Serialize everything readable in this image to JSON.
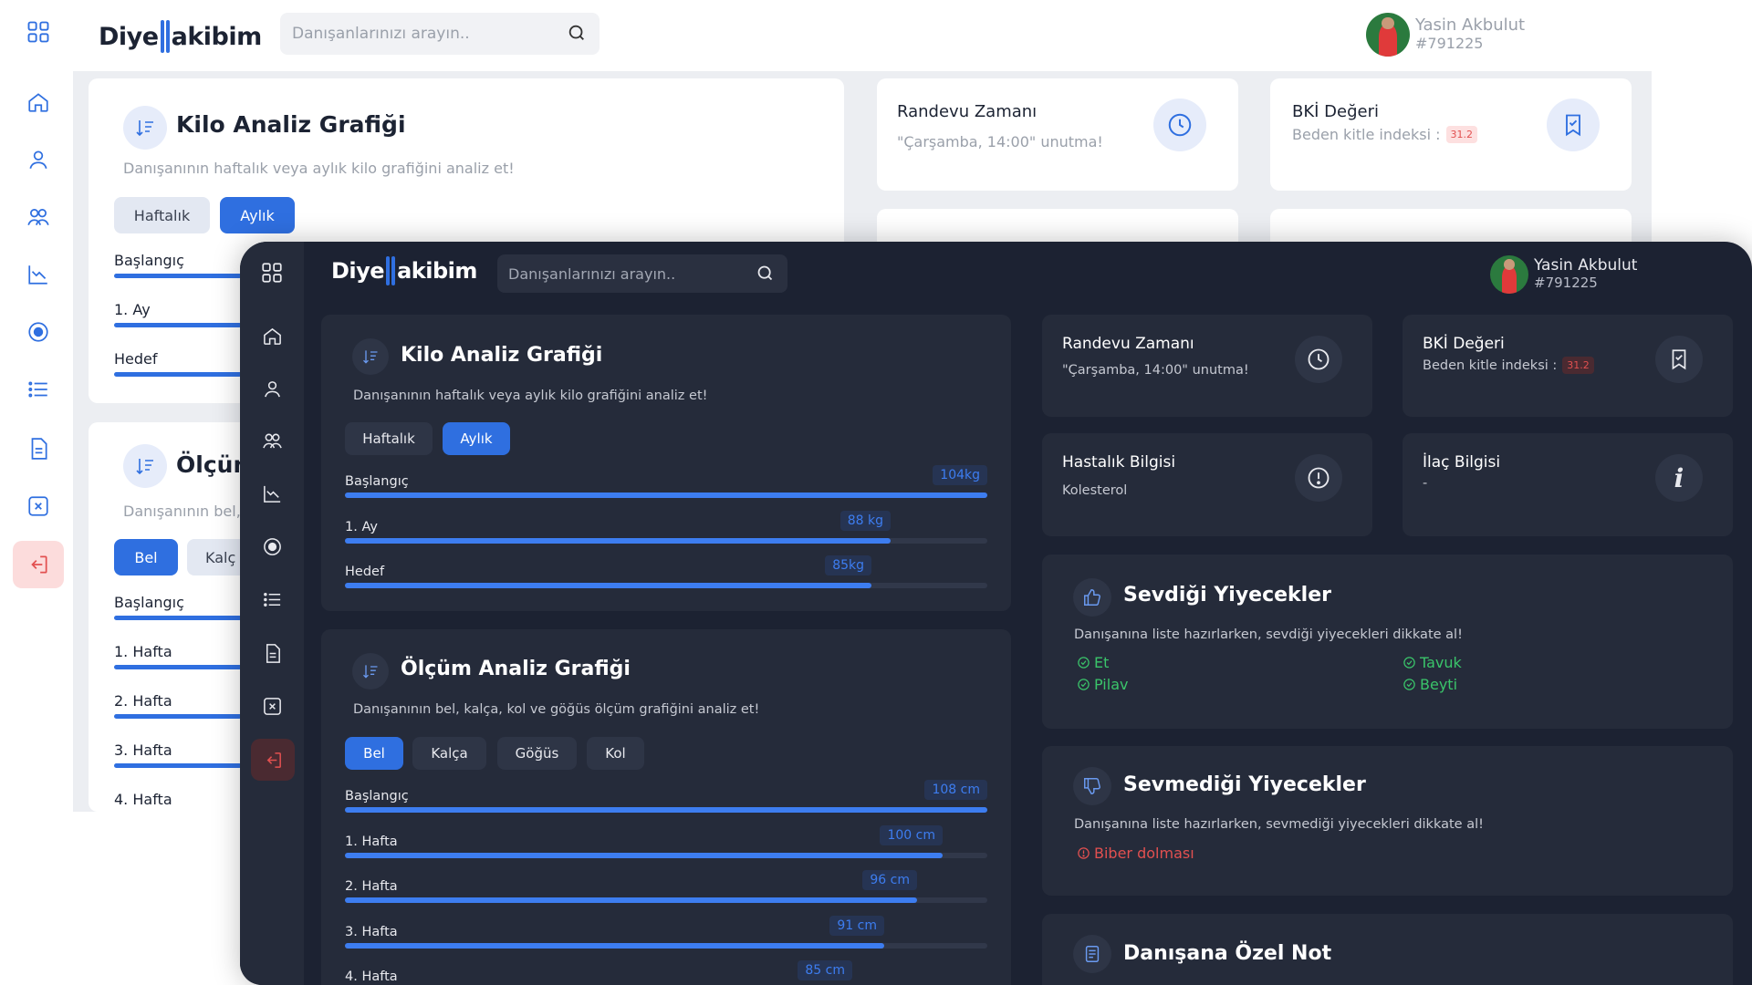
{
  "app": {
    "logo_left": "Diye",
    "logo_right": "akibim"
  },
  "search": {
    "placeholder": "Danışanlarınızı arayın.."
  },
  "user": {
    "name": "Yasin Akbulut",
    "id": "#791225"
  },
  "sidebar": {
    "icons": [
      "menu-grid-icon",
      "home-icon",
      "user-icon",
      "users-icon",
      "chart-line-icon",
      "target-icon",
      "list-icon",
      "document-icon",
      "close-square-icon",
      "logout-icon"
    ]
  },
  "kilo_chart": {
    "title": "Kilo Analiz Grafiği",
    "subtitle": "Danışanının haftalık veya aylık kilo grafiğini analiz et!",
    "tabs": [
      "Haftalık",
      "Aylık"
    ],
    "active_tab": "Aylık",
    "bars": [
      {
        "label": "Başlangıç",
        "value_label": "104kg",
        "fraction": 1.0
      },
      {
        "label": "1. Ay",
        "value_label": "88 kg",
        "fraction": 0.85
      },
      {
        "label": "Hedef",
        "value_label": "85kg",
        "fraction": 0.82
      }
    ]
  },
  "olcum_chart": {
    "title": "Ölçüm Analiz Grafiği",
    "subtitle": "Danışanının bel, kalça, kol ve göğüs ölçüm grafiğini analiz et!",
    "light_subtitle": "Danışanının bel,",
    "light_title": "Ölçün",
    "light_tab2": "Kalç",
    "tabs": [
      "Bel",
      "Kalça",
      "Göğüs",
      "Kol"
    ],
    "active_tab": "Bel",
    "bars": [
      {
        "label": "Başlangıç",
        "value_label": "108 cm",
        "fraction": 1.0
      },
      {
        "label": "1. Hafta",
        "value_label": "100 cm",
        "fraction": 0.93
      },
      {
        "label": "2. Hafta",
        "value_label": "96 cm",
        "fraction": 0.89
      },
      {
        "label": "3. Hafta",
        "value_label": "91 cm",
        "fraction": 0.84
      },
      {
        "label": "4. Hafta",
        "value_label": "85 cm",
        "fraction": 0.79
      }
    ]
  },
  "info_cards": {
    "randevu": {
      "title": "Randevu Zamanı",
      "text": "\"Çarşamba, 14:00\" unutma!"
    },
    "bki": {
      "title": "BKİ Değeri",
      "text": "Beden kitle indeksi :",
      "value": "31.2"
    },
    "hastalik": {
      "title": "Hastalık Bilgisi",
      "text": "Kolesterol"
    },
    "ilac": {
      "title": "İlaç Bilgisi",
      "text": "-"
    }
  },
  "liked_foods": {
    "title": "Sevdiği Yiyecekler",
    "subtitle": "Danışanına liste hazırlarken, sevdiği yiyecekleri dikkate al!",
    "items": [
      "Et",
      "Tavuk",
      "Pilav",
      "Beyti"
    ],
    "color": "#3ac46a"
  },
  "disliked_foods": {
    "title": "Sevmediği Yiyecekler",
    "subtitle": "Danışanına liste hazırlarken, sevmediği yiyecekleri dikkate al!",
    "items": [
      "Biber dolması"
    ],
    "color": "#e25050"
  },
  "note": {
    "title": "Danışana Özel Not"
  },
  "colors": {
    "accent": "#2f6fe0",
    "dark_bg": "#1c2232",
    "dark_card": "#252b3a",
    "danger": "#e25050"
  }
}
